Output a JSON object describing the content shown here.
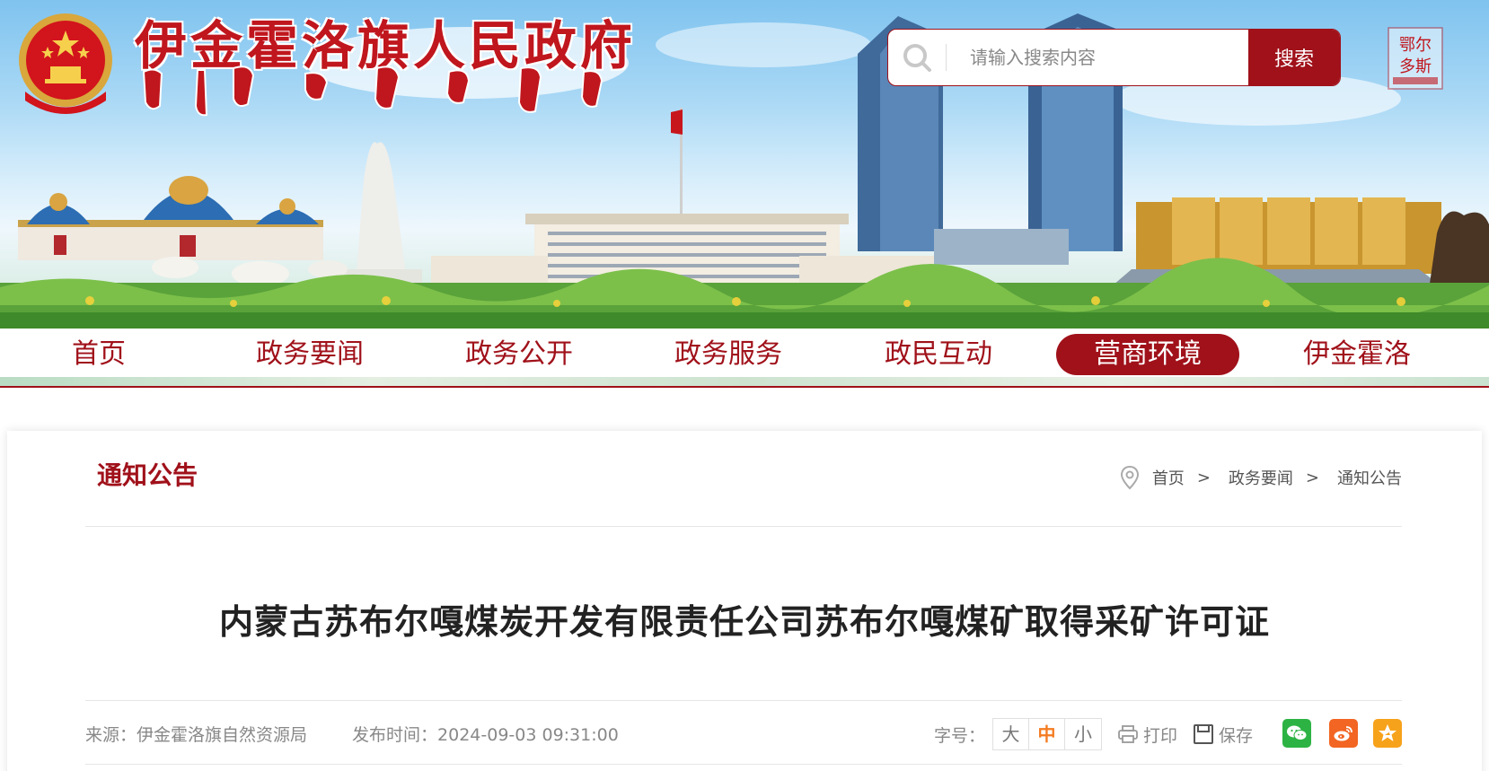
{
  "header": {
    "site_title": "伊金霍洛旗人民政府",
    "emblem": "national-emblem-icon",
    "side_logo": "ordos-logo",
    "side_logo_text": "鄂尔多斯"
  },
  "search": {
    "placeholder": "请输入搜索内容",
    "button_label": "搜索"
  },
  "nav": {
    "items": [
      {
        "label": "首页"
      },
      {
        "label": "政务要闻"
      },
      {
        "label": "政务公开"
      },
      {
        "label": "政务服务"
      },
      {
        "label": "政民互动"
      },
      {
        "label": "营商环境",
        "active": true
      },
      {
        "label": "伊金霍洛"
      }
    ]
  },
  "section": {
    "title": "通知公告"
  },
  "breadcrumb": {
    "items": [
      "首页",
      "政务要闻",
      "通知公告"
    ],
    "separator": ">"
  },
  "article": {
    "title": "内蒙古苏布尔嘎煤炭开发有限责任公司苏布尔嘎煤矿取得采矿许可证",
    "source": "来源：伊金霍洛旗自然资源局",
    "publish_time": "发布时间：2024-09-03 09:31:00"
  },
  "tools": {
    "font_size_label": "字号：",
    "font_sizes": [
      "大",
      "中",
      "小"
    ],
    "font_size_active": "中",
    "print_label": "打印",
    "save_label": "保存"
  },
  "share": [
    {
      "icon": "wechat-icon",
      "color": "#2db344"
    },
    {
      "icon": "weibo-icon",
      "color": "#f26522"
    },
    {
      "icon": "qzone-icon",
      "color": "#f7a21b"
    }
  ],
  "colors": {
    "brand_red": "#a0111a",
    "title_red": "#c0161d",
    "active_font": "#f47b20"
  }
}
